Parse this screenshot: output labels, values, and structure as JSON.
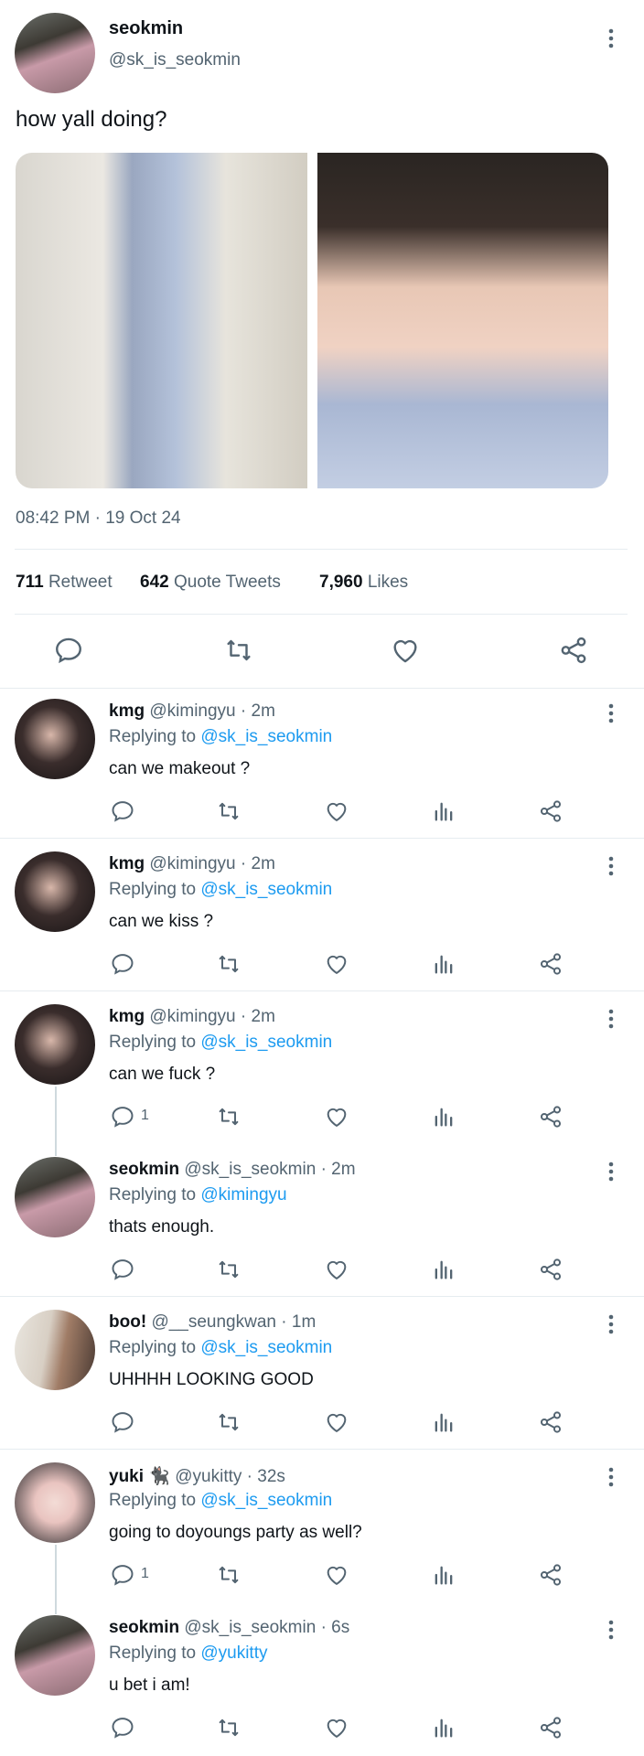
{
  "main_tweet": {
    "name": "seokmin",
    "handle": "@sk_is_seokmin",
    "text": "how yall doing?",
    "timestamp": "08:42 PM · 19 Oct 24",
    "stats": {
      "retweets_count": "711",
      "retweets_label": "Retweet",
      "quotes_count": "642",
      "quotes_label": "Quote Tweets",
      "likes_count": "7,960",
      "likes_label": "Likes"
    }
  },
  "replies": [
    {
      "name": "kmg",
      "handle": "@kimingyu",
      "time": "2m",
      "replying_label": "Replying to",
      "replying_to": "@sk_is_seokmin",
      "text": "can we makeout ?",
      "reply_count": ""
    },
    {
      "name": "kmg",
      "handle": "@kimingyu",
      "time": "2m",
      "replying_label": "Replying to",
      "replying_to": "@sk_is_seokmin",
      "text": "can we kiss ?",
      "reply_count": ""
    },
    {
      "name": "kmg",
      "handle": "@kimingyu",
      "time": "2m",
      "replying_label": "Replying to",
      "replying_to": "@sk_is_seokmin",
      "text": "can we fuck ?",
      "reply_count": "1"
    },
    {
      "name": "seokmin",
      "handle": "@sk_is_seokmin",
      "time": "2m",
      "replying_label": "Replying to",
      "replying_to": "@kimingyu",
      "text": "thats enough.",
      "reply_count": ""
    },
    {
      "name": "boo!",
      "handle": "@__seungkwan",
      "time": "1m",
      "replying_label": "Replying to",
      "replying_to": "@sk_is_seokmin",
      "text": "UHHHH LOOKING GOOD",
      "reply_count": ""
    },
    {
      "name": "yuki 🐈‍⬛",
      "handle": "@yukitty",
      "time": "32s",
      "replying_label": "Replying to",
      "replying_to": "@sk_is_seokmin",
      "text": "going to doyoungs party as well?",
      "reply_count": "1"
    },
    {
      "name": "seokmin",
      "handle": "@sk_is_seokmin",
      "time": "6s",
      "replying_label": "Replying to",
      "replying_to": "@yukitty",
      "text": "u bet i am!",
      "reply_count": ""
    }
  ],
  "colors": {
    "accent": "#1d9bf0",
    "text": "#0f1419",
    "muted": "#536471",
    "divider": "#e6ecf0"
  },
  "icons": [
    "more-icon",
    "reply-icon",
    "retweet-icon",
    "like-icon",
    "views-icon",
    "share-icon"
  ]
}
